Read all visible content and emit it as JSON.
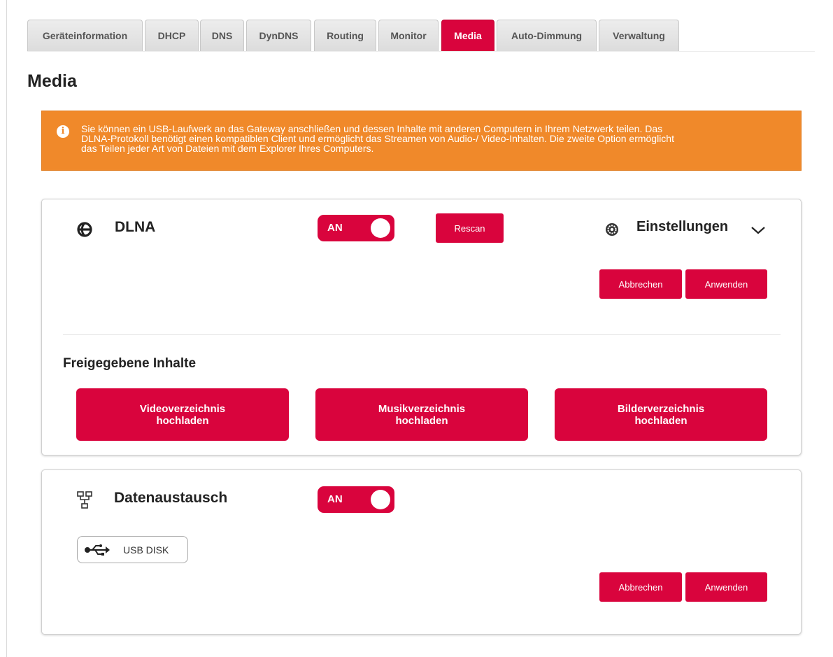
{
  "tabs": [
    {
      "label": "Geräteinformation",
      "active": false
    },
    {
      "label": "DHCP",
      "active": false
    },
    {
      "label": "DNS",
      "active": false
    },
    {
      "label": "DynDNS",
      "active": false
    },
    {
      "label": "Routing",
      "active": false
    },
    {
      "label": "Monitor",
      "active": false
    },
    {
      "label": "Media",
      "active": true
    },
    {
      "label": "Auto-Dimmung",
      "active": false
    },
    {
      "label": "Verwaltung",
      "active": false
    }
  ],
  "page": {
    "title": "Media"
  },
  "info": {
    "icon": "info-circle-icon",
    "lines": [
      "Sie können ein USB-Laufwerk an das Gateway anschließen und dessen Inhalte mit anderen Computern in Ihrem Netzwerk teilen. Das",
      "DLNA-Protokoll benötigt einen kompatiblen Client und ermöglicht das Streamen von Audio-/ Video-Inhalten. Die zweite Option ermöglicht",
      "das Teilen jeder Art von Dateien mit dem Explorer Ihres Computers."
    ]
  },
  "dlna": {
    "icon": "dlna-icon",
    "title": "DLNA",
    "toggle": {
      "label": "AN",
      "on": true
    },
    "rescan_label": "Rescan",
    "settings": {
      "icon": "gear-icon",
      "label": "Einstellungen",
      "chevron": "chevron-down-icon"
    },
    "cancel_label": "Abbrechen",
    "apply_label": "Anwenden",
    "shared_heading": "Freigegebene Inhalte",
    "uploads": [
      {
        "line1": "Videoverzeichnis",
        "line2": "hochladen"
      },
      {
        "line1": "Musikverzeichnis",
        "line2": "hochladen"
      },
      {
        "line1": "Bilderverzeichnis",
        "line2": "hochladen"
      }
    ]
  },
  "datenaustausch": {
    "icon": "network-icon",
    "title": "Datenaustausch",
    "toggle": {
      "label": "AN",
      "on": true
    },
    "usb": {
      "icon": "usb-icon",
      "label": "USB DISK"
    },
    "cancel_label": "Abbrechen",
    "apply_label": "Anwenden"
  },
  "colors": {
    "accent": "#d9043d",
    "info_banner": "#f0892a",
    "tab_inactive": "#e4e4e4",
    "text": "#222222"
  }
}
